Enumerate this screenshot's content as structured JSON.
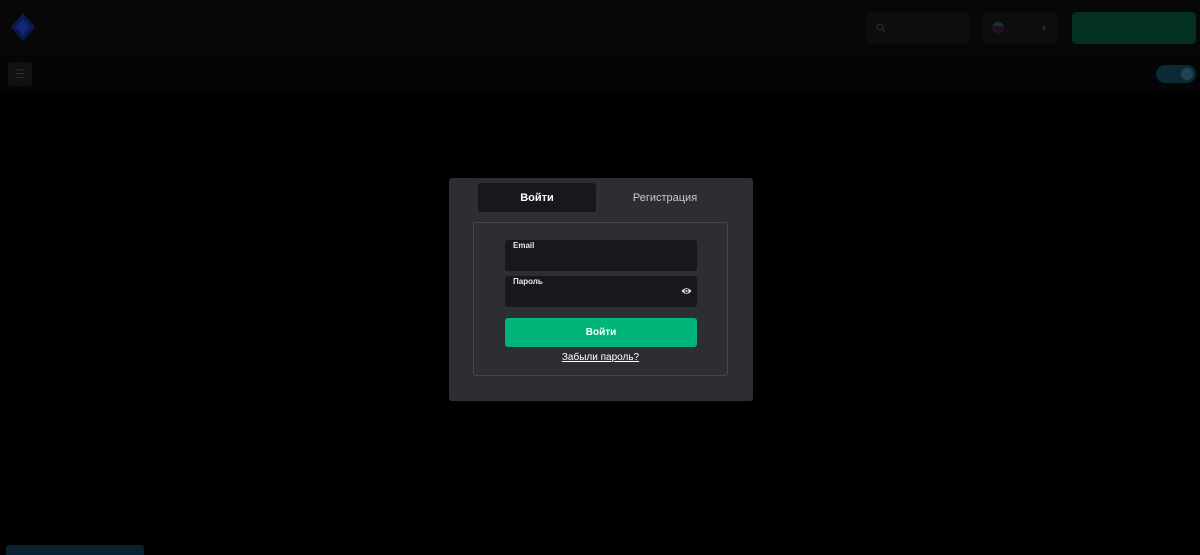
{
  "header": {
    "logo_icon": "diamond-logo-icon",
    "search": {
      "icon": "search-icon",
      "label": ""
    },
    "language": {
      "icon": "flag-icon",
      "value": ""
    },
    "action_button_label": ""
  },
  "subheader": {
    "menu_icon": "menu-icon",
    "theme_label": "",
    "theme_toggle_on": true
  },
  "modal": {
    "tabs": [
      {
        "label": "Войти",
        "active": true
      },
      {
        "label": "Регистрация",
        "active": false
      }
    ],
    "form": {
      "email": {
        "label": "Email",
        "value": ""
      },
      "password": {
        "label": "Пароль",
        "value": "",
        "icon": "eye-icon"
      },
      "submit_label": "Войти",
      "forgot_label": "Забыли пароль?"
    }
  },
  "colors": {
    "background": "#000000",
    "modal_bg": "#2c2e32",
    "field_bg": "#17181b",
    "accent_green": "#00b47a",
    "toggle_blue": "#0a2a36"
  }
}
